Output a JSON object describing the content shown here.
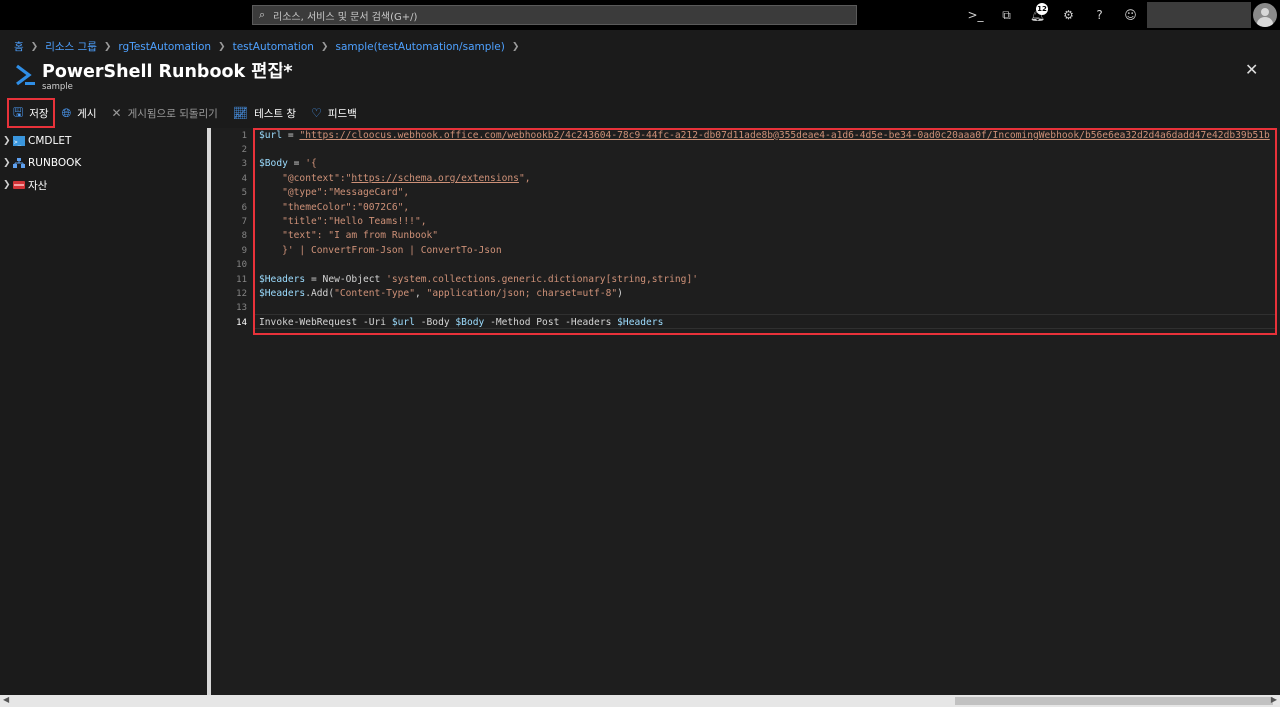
{
  "search": {
    "placeholder": "리소스, 서비스 및 문서 검색(G+/)"
  },
  "topbar": {
    "notification_count": "12",
    "icons": [
      "cloud-shell-icon",
      "directory-filter-icon",
      "bell-icon",
      "gear-icon",
      "help-icon",
      "feedback-icon"
    ]
  },
  "breadcrumb": [
    "홈",
    "리소스 그룹",
    "rgTestAutomation",
    "testAutomation",
    "sample(testAutomation/sample)"
  ],
  "header": {
    "title": "PowerShell Runbook 편집*",
    "subtitle": "sample",
    "more": "···"
  },
  "toolbar": {
    "save": "저장",
    "publish": "게시",
    "revert": "게시됨으로 되돌리기",
    "test_pane": "테스트 창",
    "feedback": "피드백"
  },
  "tree": [
    "CMDLET",
    "RUNBOOK",
    "자산"
  ],
  "code": {
    "line_numbers": [
      "1",
      "2",
      "3",
      "4",
      "5",
      "6",
      "7",
      "8",
      "9",
      "10",
      "11",
      "12",
      "13",
      "14"
    ],
    "lines": [
      [
        "$url",
        " = ",
        "\"https://cloocus.webhook.office.com/webhookb2/4c243604-78c9-44fc-a212-db07d11ade8b@355deae4-a1d6-4d5e-be34-0ad0c20aaa0f/IncomingWebhook/b56e6ea32d2d4a6dadd47e42db39b51b"
      ],
      [
        ""
      ],
      [
        "$Body",
        " = ",
        "'{"
      ],
      [
        "    \"@context\":\"",
        "https://schema.org/extensions",
        "\","
      ],
      [
        "    \"@type\":\"MessageCard\","
      ],
      [
        "    \"themeColor\":\"0072C6\","
      ],
      [
        "    \"title\":\"Hello Teams!!!\","
      ],
      [
        "    \"text\": \"I am from Runbook\""
      ],
      [
        "    }' | ConvertFrom-Json | ConvertTo-Json"
      ],
      [
        ""
      ],
      [
        "$Headers",
        " = New-Object ",
        "'system.collections.generic.dictionary[string,string]'"
      ],
      [
        "$Headers",
        ".Add(",
        "\"Content-Type\"",
        ", ",
        "\"application/json; charset=utf-8\"",
        ")"
      ],
      [
        ""
      ],
      [
        "Invoke-WebRequest -Uri ",
        "$url",
        " -Body ",
        "$Body",
        " -Method Post -Headers ",
        "$Headers"
      ]
    ]
  },
  "colors": {
    "accent": "#4ea1ff",
    "highlight_border": "#e8323a",
    "variable": "#9cdcfe",
    "string": "#ce9178"
  }
}
